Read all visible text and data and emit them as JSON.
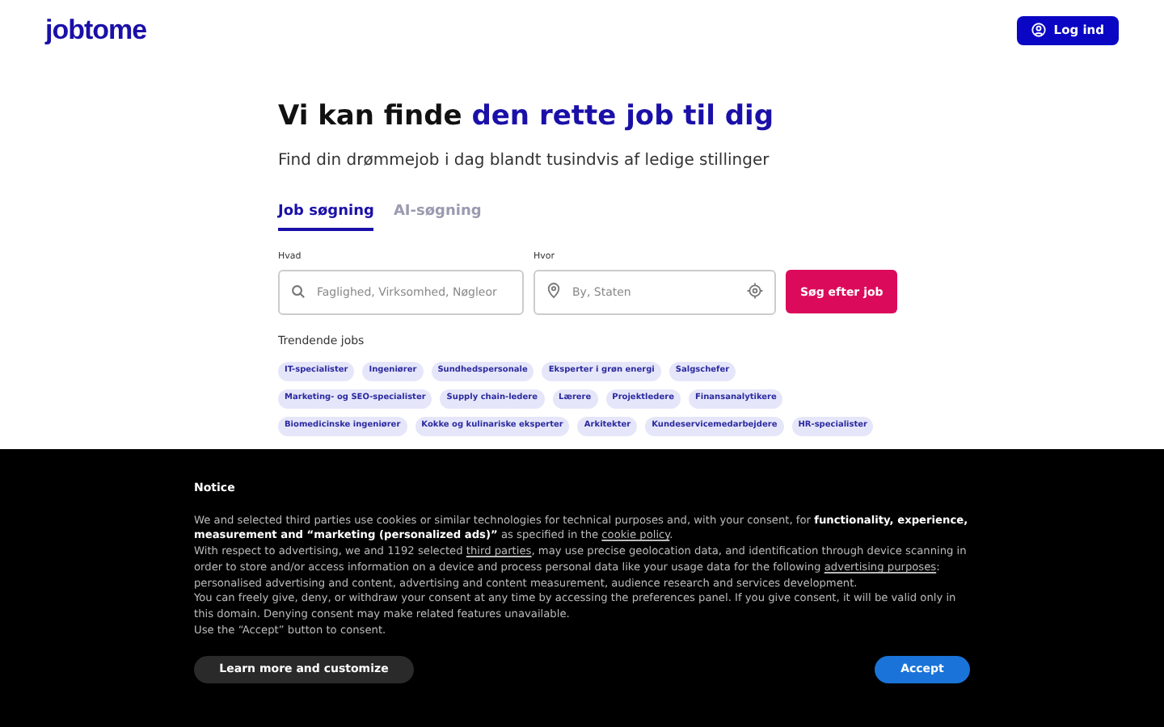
{
  "header": {
    "logo": "jobtome",
    "login_button": "Log ind"
  },
  "hero": {
    "title_prefix": "Vi kan finde",
    "title_highlight": "den rette job til dig",
    "subtitle": "Find din drømmejob i dag blandt tusindvis af ledige stillinger"
  },
  "tabs": [
    {
      "label": "Job søgning",
      "selected": true
    },
    {
      "label": "AI-søgning",
      "selected": false
    }
  ],
  "search": {
    "what_label": "Hvad",
    "what_placeholder": "Faglighed, Virksomhed, Nøgleor",
    "where_label": "Hvor",
    "where_placeholder": "By, Staten",
    "button": "Søg efter job"
  },
  "trending": {
    "title": "Trendende jobs",
    "tags": [
      "IT-specialister",
      "Ingeniører",
      "Sundhedspersonale",
      "Eksperter i grøn energi",
      "Salgschefer",
      "Marketing- og SEO-specialister",
      "Supply chain-ledere",
      "Lærere",
      "Projektledere",
      "Finansanalytikere",
      "Biomedicinske ingeniører",
      "Kokke og kulinariske eksperter",
      "Arkitekter",
      "Kundeservicemedarbejdere",
      "HR-specialister"
    ]
  },
  "notice": {
    "title": "Notice",
    "paragraphs": [
      [
        {
          "kind": "text",
          "text": "We and selected third parties use cookies or similar technologies for technical purposes and, with your consent, for "
        },
        {
          "kind": "bold",
          "text": "functionality, experience, measurement and “marketing (personalized ads)”"
        },
        {
          "kind": "text",
          "text": " as specified in the "
        },
        {
          "kind": "link",
          "text": "cookie policy"
        },
        {
          "kind": "text",
          "text": "."
        }
      ],
      [
        {
          "kind": "text",
          "text": "With respect to advertising, we and 1192 selected "
        },
        {
          "kind": "link",
          "text": "third parties"
        },
        {
          "kind": "text",
          "text": ", may use precise geolocation data, and identification through device scanning in order to store and/or access information on a device and process personal data like your usage data for the following "
        },
        {
          "kind": "link",
          "text": "advertising purposes"
        },
        {
          "kind": "text",
          "text": ": personalised advertising and content, advertising and content measurement, audience research and services development."
        }
      ],
      [
        {
          "kind": "text",
          "text": "You can freely give, deny, or withdraw your consent at any time by accessing the preferences panel. If you give consent, it will be valid only in this domain. Denying consent may make related features unavailable."
        }
      ],
      [
        {
          "kind": "text",
          "text": "Use the “Accept” button to consent."
        }
      ]
    ],
    "learn_button": "Learn more and customize",
    "accept_button": "Accept"
  }
}
